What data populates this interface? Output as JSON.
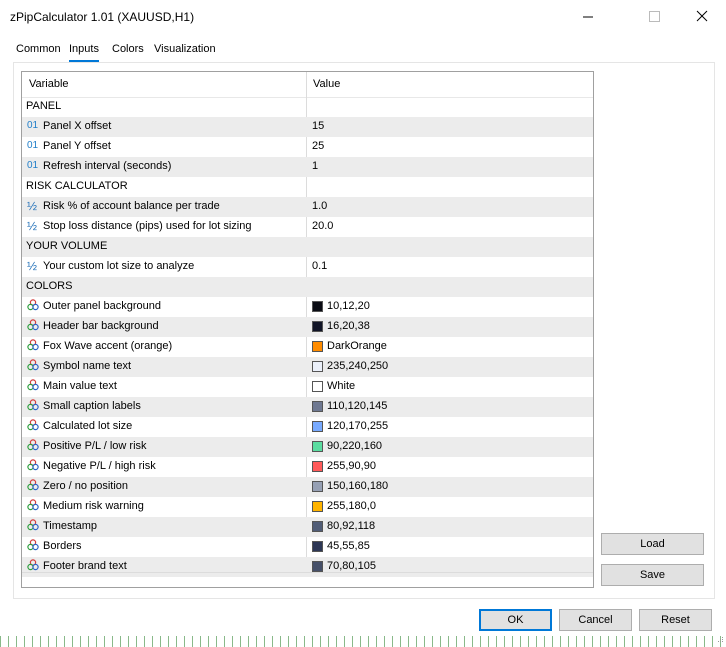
{
  "window": {
    "title": "zPipCalculator 1.01 (XAUUSD,H1)"
  },
  "tabs": [
    {
      "label": "Common"
    },
    {
      "label": "Inputs"
    },
    {
      "label": "Colors"
    },
    {
      "label": "Visualization"
    }
  ],
  "grid": {
    "headers": {
      "variable": "Variable",
      "value": "Value"
    },
    "rows": [
      {
        "type": "section",
        "label": "PANEL",
        "value": ""
      },
      {
        "type": "int",
        "label": "Panel X offset",
        "value": "15"
      },
      {
        "type": "int",
        "label": "Panel Y offset",
        "value": "25"
      },
      {
        "type": "int",
        "label": "Refresh interval (seconds)",
        "value": "1"
      },
      {
        "type": "section",
        "label": "RISK CALCULATOR",
        "value": ""
      },
      {
        "type": "double",
        "label": "Risk % of account balance per trade",
        "value": "1.0"
      },
      {
        "type": "double",
        "label": "Stop loss distance (pips) used for lot sizing",
        "value": "20.0"
      },
      {
        "type": "section",
        "label": "YOUR VOLUME",
        "value": ""
      },
      {
        "type": "double",
        "label": "Your custom lot size to analyze",
        "value": "0.1"
      },
      {
        "type": "section",
        "label": "COLORS",
        "value": ""
      },
      {
        "type": "color",
        "label": "Outer panel background",
        "value": "10,12,20",
        "swatch": "#0a0c14"
      },
      {
        "type": "color",
        "label": "Header bar background",
        "value": "16,20,38",
        "swatch": "#101426"
      },
      {
        "type": "color",
        "label": "Fox Wave accent (orange)",
        "value": "DarkOrange",
        "swatch": "#ff8c00"
      },
      {
        "type": "color",
        "label": "Symbol name text",
        "value": "235,240,250",
        "swatch": "#ebf0fa"
      },
      {
        "type": "color",
        "label": "Main value text",
        "value": "White",
        "swatch": "#ffffff"
      },
      {
        "type": "color",
        "label": "Small caption labels",
        "value": "110,120,145",
        "swatch": "#6e7891"
      },
      {
        "type": "color",
        "label": "Calculated lot size",
        "value": "120,170,255",
        "swatch": "#78aaff"
      },
      {
        "type": "color",
        "label": "Positive P/L / low risk",
        "value": "90,220,160",
        "swatch": "#5adca0"
      },
      {
        "type": "color",
        "label": "Negative P/L / high risk",
        "value": "255,90,90",
        "swatch": "#ff5a5a"
      },
      {
        "type": "color",
        "label": "Zero / no position",
        "value": "150,160,180",
        "swatch": "#96a0b4"
      },
      {
        "type": "color",
        "label": "Medium risk warning",
        "value": "255,180,0",
        "swatch": "#ffb400"
      },
      {
        "type": "color",
        "label": "Timestamp",
        "value": "80,92,118",
        "swatch": "#505c76"
      },
      {
        "type": "color",
        "label": "Borders",
        "value": "45,55,85",
        "swatch": "#2d3755"
      },
      {
        "type": "color",
        "label": "Footer brand text",
        "value": "70,80,105",
        "swatch": "#465069"
      }
    ]
  },
  "side_buttons": {
    "load": "Load",
    "save": "Save"
  },
  "footer_buttons": {
    "ok": "OK",
    "cancel": "Cancel",
    "reset": "Reset"
  },
  "icons": {
    "int": "01",
    "double": "½",
    "color": "color-circles-icon"
  },
  "colors": {
    "accent": "#0078d7",
    "row_alt": "#ececec"
  }
}
